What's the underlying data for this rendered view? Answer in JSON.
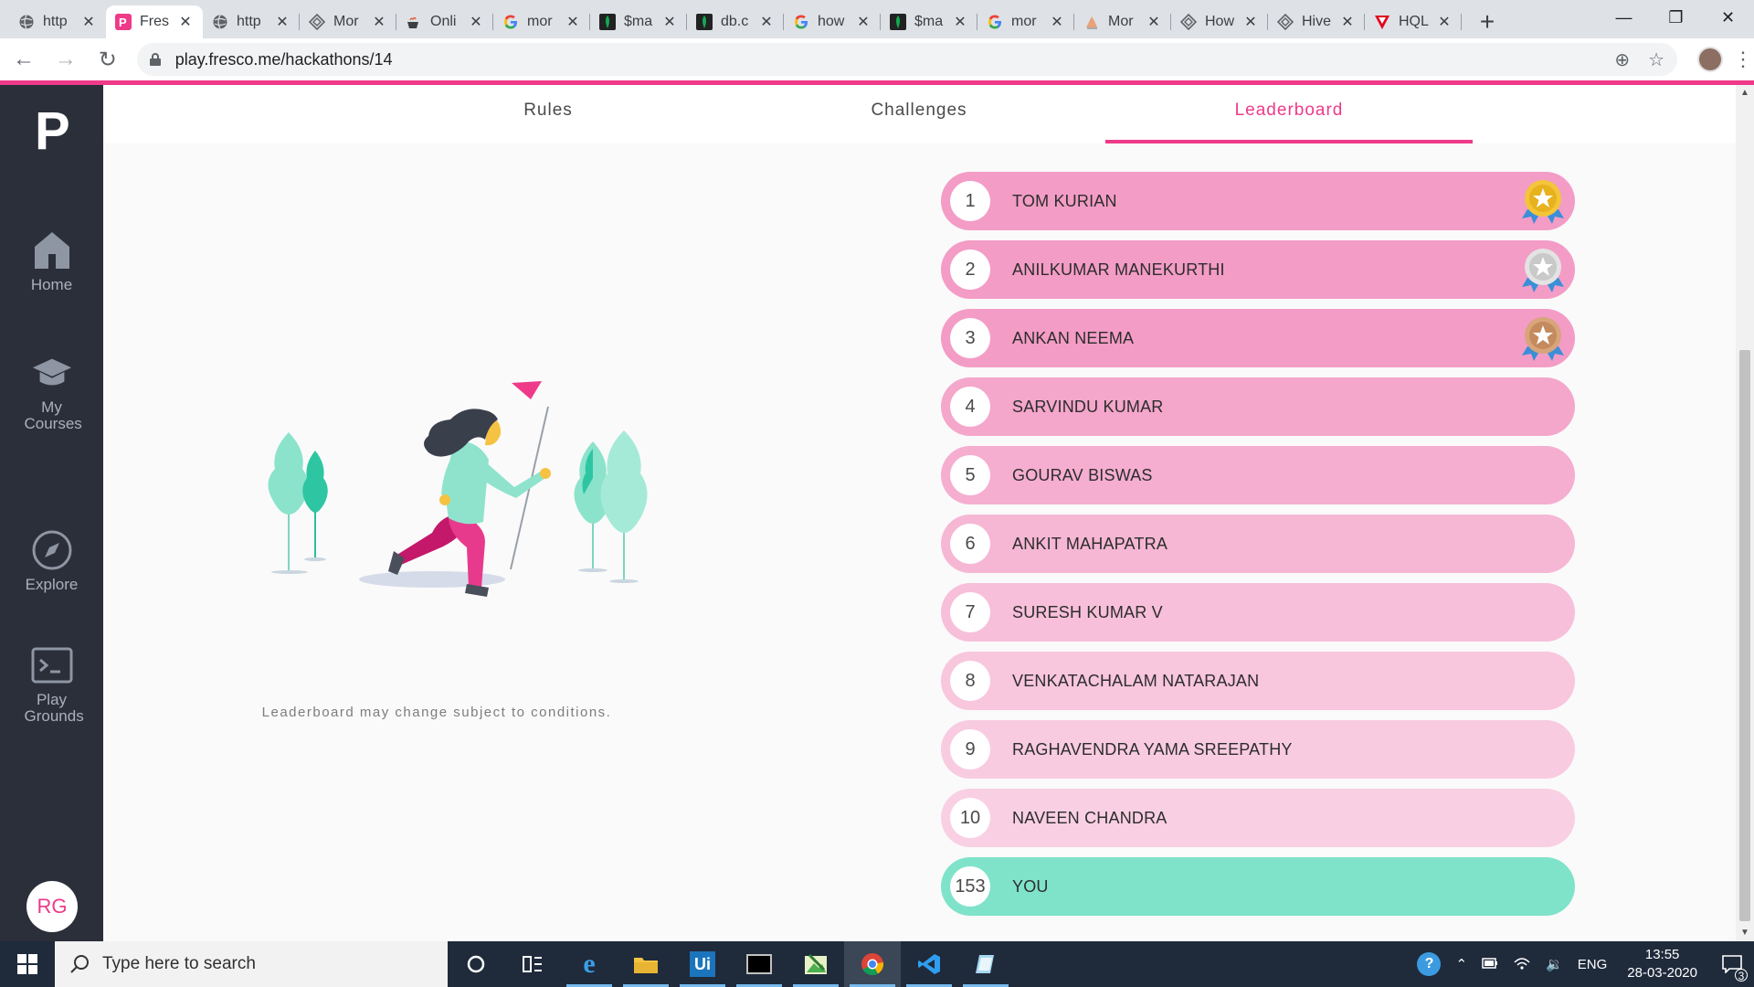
{
  "browser": {
    "tabs": [
      {
        "title": "http",
        "favicon": "globe-icon",
        "color": "#5f6368"
      },
      {
        "title": "Fres",
        "favicon": "fresco-icon",
        "color": "#ee3a89",
        "active": true
      },
      {
        "title": "http",
        "favicon": "globe-icon",
        "color": "#5f6368"
      },
      {
        "title": "Mor",
        "favicon": "diamond-icon",
        "color": "#5f6368"
      },
      {
        "title": "Onli",
        "favicon": "coffee-icon",
        "color": "#5f6368"
      },
      {
        "title": "mor",
        "favicon": "google-icon",
        "color": "#4285f4"
      },
      {
        "title": "$ma",
        "favicon": "mongodb-icon",
        "color": "#13aa52"
      },
      {
        "title": "db.c",
        "favicon": "mongodb-icon",
        "color": "#13aa52"
      },
      {
        "title": "how",
        "favicon": "google-icon",
        "color": "#4285f4"
      },
      {
        "title": "$ma",
        "favicon": "mongodb-icon",
        "color": "#13aa52"
      },
      {
        "title": "mor",
        "favicon": "google-icon",
        "color": "#4285f4"
      },
      {
        "title": "Mor",
        "favicon": "bookmark-icon",
        "color": "#e8a178"
      },
      {
        "title": "How",
        "favicon": "diamond-icon",
        "color": "#5f6368"
      },
      {
        "title": "Hive",
        "favicon": "diamond-icon",
        "color": "#5f6368"
      },
      {
        "title": "HQL",
        "favicon": "triangle-icon",
        "color": "#e3001b"
      }
    ],
    "url": "play.fresco.me/hackathons/14"
  },
  "sidebar": {
    "logo": "P",
    "items": [
      {
        "label": "Home",
        "icon": "home-icon"
      },
      {
        "label": "My Courses",
        "icon": "graduation-cap-icon"
      },
      {
        "label": "Explore",
        "icon": "compass-icon"
      },
      {
        "label": "Play Grounds",
        "icon": "terminal-icon"
      }
    ],
    "avatar_initials": "RG"
  },
  "page_tabs": [
    {
      "label": "Rules"
    },
    {
      "label": "Challenges"
    },
    {
      "label": "Leaderboard",
      "active": true
    }
  ],
  "disclaimer": "Leaderboard may change subject to conditions.",
  "leaderboard": [
    {
      "rank": "1",
      "name": "TOM KURIAN",
      "medal": "gold",
      "color": "#f39cc6"
    },
    {
      "rank": "2",
      "name": "ANILKUMAR MANEKURTHI",
      "medal": "silver",
      "color": "#f39cc6"
    },
    {
      "rank": "3",
      "name": "ANKAN NEEMA",
      "medal": "bronze",
      "color": "#f39cc6"
    },
    {
      "rank": "4",
      "name": "SARVINDU KUMAR",
      "color": "#f4a6cb"
    },
    {
      "rank": "5",
      "name": "GOURAV BISWAS",
      "color": "#f5aed0"
    },
    {
      "rank": "6",
      "name": "ANKIT MAHAPATRA",
      "color": "#f6b7d4"
    },
    {
      "rank": "7",
      "name": "SURESH KUMAR V",
      "color": "#f7bfd9"
    },
    {
      "rank": "8",
      "name": "VENKATACHALAM NATARAJAN",
      "color": "#f8c6dd"
    },
    {
      "rank": "9",
      "name": "RAGHAVENDRA YAMA SREEPATHY",
      "color": "#f8cbe0"
    },
    {
      "rank": "10",
      "name": "NAVEEN CHANDRA",
      "color": "#f9d0e3"
    },
    {
      "rank": "153",
      "name": "YOU",
      "color": "#7fe3c9"
    }
  ],
  "taskbar": {
    "search_placeholder": "Type here to search",
    "lang": "ENG",
    "time": "13:55",
    "date": "28-03-2020",
    "notifications": "3"
  },
  "colors": {
    "accent": "#ee3a89",
    "sidebar_bg": "#2b2f3a",
    "taskbar_bg": "#1f2a3b",
    "you_row": "#7fe3c9"
  }
}
